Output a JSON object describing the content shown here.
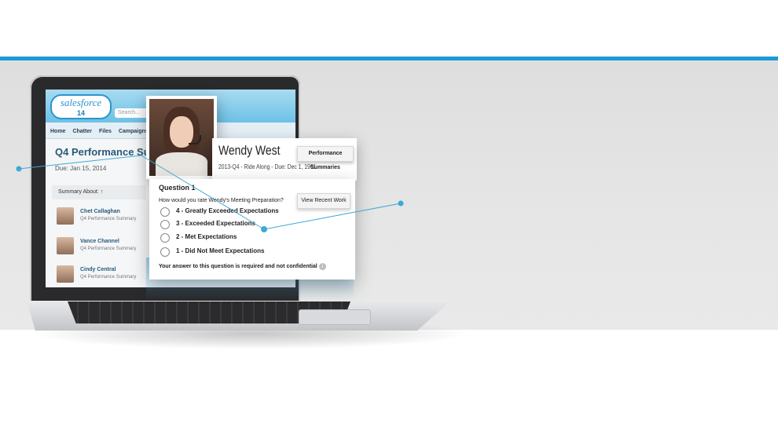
{
  "colors": {
    "accent": "#1a9ad8",
    "callout": "#3fa9d6"
  },
  "laptop_screen": {
    "logo_text": "salesforce",
    "logo_version": "14",
    "search_placeholder": "Search...",
    "nav": [
      "Home",
      "Chatter",
      "Files",
      "Campaigns",
      "Le"
    ],
    "page_title": "Q4 Performance Sum",
    "due_date": "Due: Jan 15, 2014",
    "summary_about": "Summary About:",
    "people": [
      {
        "name": "Chet Callaghan",
        "subtitle": "Q4 Performance Summary"
      },
      {
        "name": "Vance Channel",
        "subtitle": "Q4 Performance Summary"
      },
      {
        "name": "Cindy Central",
        "subtitle": "Q4 Performance Summary"
      }
    ]
  },
  "profile": {
    "name": "Wendy West",
    "subtitle": "2013-Q4 - Ride Along - Due: Dec 1, 1901",
    "performance_button": "Performance Summaries"
  },
  "question": {
    "title": "Question 1",
    "text": "How would you rate Wendy's Meeting Preparation?",
    "view_button": "View Recent Work",
    "options": [
      "4 - Greatly Exceeded Expectations",
      "3 - Exceeded Expectations",
      "2 - Met Expectations",
      "1 - Did Not Meet Expectations"
    ],
    "note": "Your answer to this question is required and not confidential",
    "info_icon": "info-icon"
  }
}
